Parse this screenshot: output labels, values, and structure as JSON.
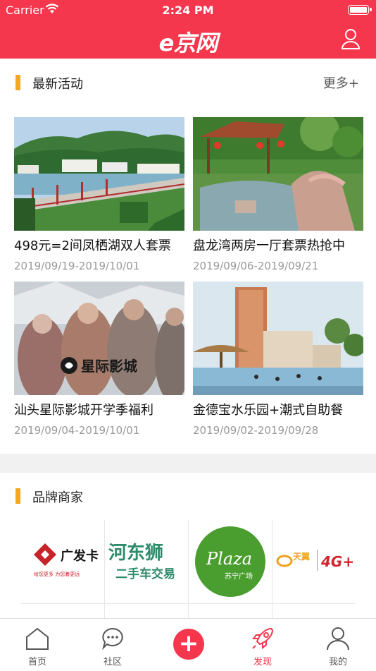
{
  "status_bar": {
    "carrier": "Carrier",
    "time": "2:24 PM"
  },
  "header": {
    "logo_text": "e京网"
  },
  "activities": {
    "title": "最新活动",
    "more": "更多+",
    "items": [
      {
        "name": "498元=2间凤栖湖双人套票",
        "date": "2019/09/19-2019/10/01"
      },
      {
        "name": "盘龙湾两房一厅套票热抢中",
        "date": "2019/09/06-2019/09/21"
      },
      {
        "name": "汕头星际影城开学季福利",
        "date": "2019/09/04-2019/10/01",
        "image_text": "星际影城"
      },
      {
        "name": "金德宝水乐园+潮式自助餐",
        "date": "2019/09/02-2019/09/28"
      }
    ]
  },
  "brands": {
    "title": "品牌商家",
    "items": [
      {
        "name": "广发卡",
        "sub": "给您更多 为您着更远"
      },
      {
        "name": "河东狮",
        "sub": "二手车交易"
      },
      {
        "name": "Plaza",
        "sub": "苏宁广场"
      },
      {
        "name": "天翼",
        "sub": "4G+"
      }
    ]
  },
  "tabbar": {
    "items": [
      {
        "label": "首页",
        "icon": "home-icon"
      },
      {
        "label": "社区",
        "icon": "chat-icon"
      },
      {
        "label": "",
        "icon": "plus-icon"
      },
      {
        "label": "发现",
        "icon": "rocket-icon"
      },
      {
        "label": "我的",
        "icon": "user-icon"
      }
    ]
  },
  "colors": {
    "brand_red": "#f5374d",
    "accent_orange": "#f5a623",
    "date_gray": "#999999"
  }
}
